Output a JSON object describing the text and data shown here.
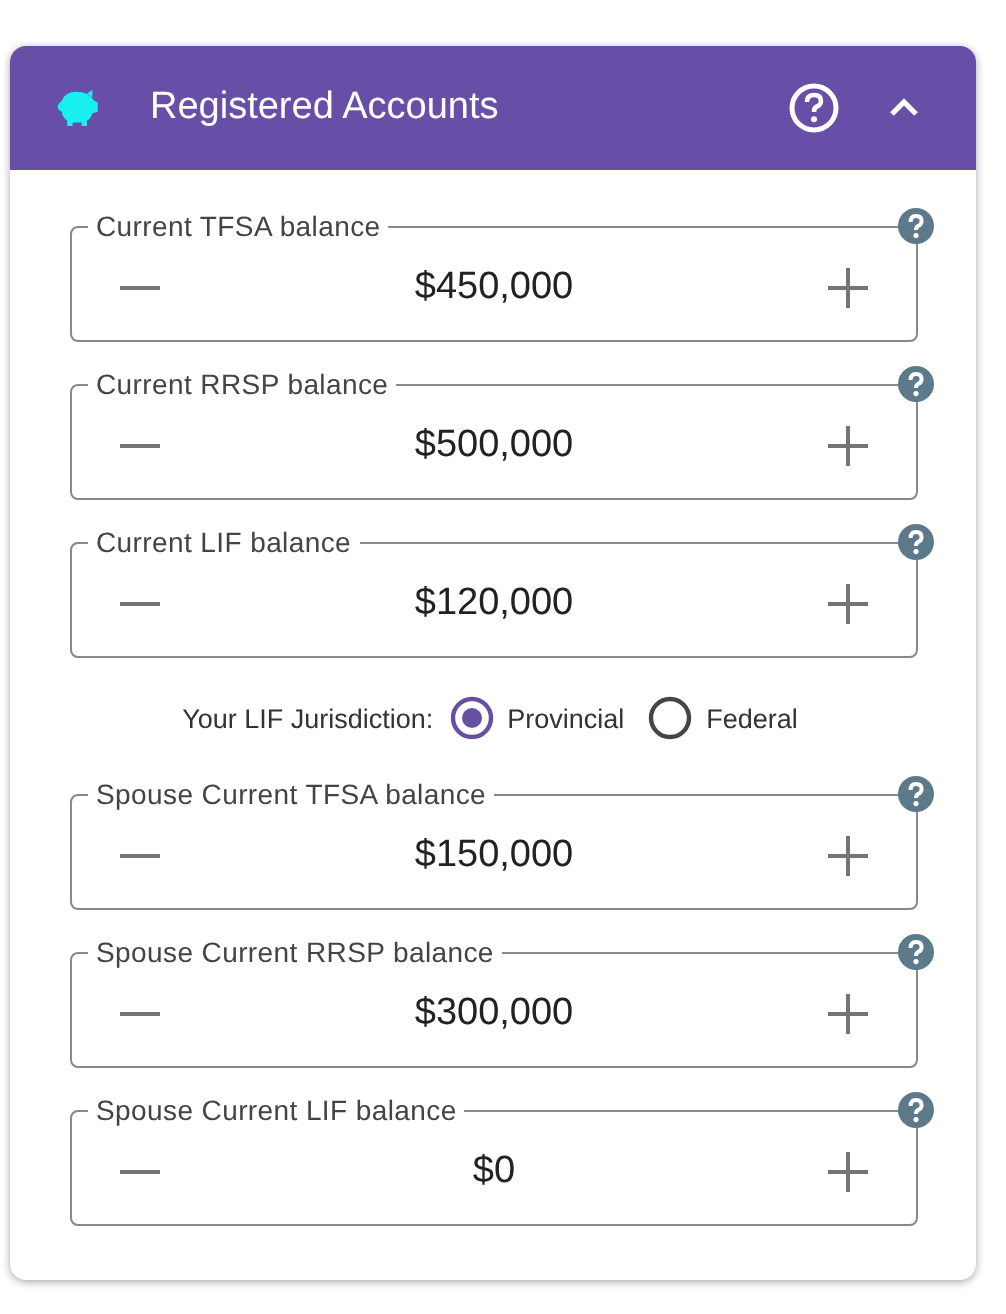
{
  "panel": {
    "title": "Registered Accounts",
    "expanded": true
  },
  "fields": [
    {
      "kind": "amount",
      "label": "Current TFSA balance",
      "value": "$450,000"
    },
    {
      "kind": "amount",
      "label": "Current RRSP balance",
      "value": "$500,000"
    },
    {
      "kind": "amount",
      "label": "Current LIF balance",
      "value": "$120,000"
    },
    {
      "kind": "radio-group",
      "label": "Your LIF Jurisdiction:",
      "options": [
        {
          "label": "Provincial",
          "selected": true
        },
        {
          "label": "Federal",
          "selected": false
        }
      ]
    },
    {
      "kind": "amount",
      "label": "Spouse Current TFSA balance",
      "value": "$150,000"
    },
    {
      "kind": "amount",
      "label": "Spouse Current RRSP balance",
      "value": "$300,000"
    },
    {
      "kind": "amount",
      "label": "Spouse Current LIF balance",
      "value": "$0"
    }
  ]
}
